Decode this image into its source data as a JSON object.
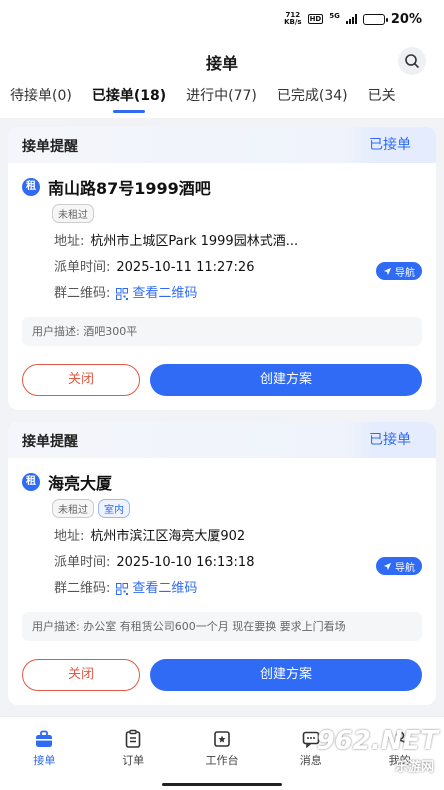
{
  "status_bar": {
    "speed": "712",
    "speed_unit": "KB/s",
    "hd": "HD",
    "network": "5G",
    "battery_level": 0.2,
    "battery": "20%"
  },
  "header": {
    "title": "接单"
  },
  "tabs": [
    {
      "label": "待接单(0)"
    },
    {
      "label": "已接单(18)",
      "active": true
    },
    {
      "label": "进行中(77)"
    },
    {
      "label": "已完成(34)"
    },
    {
      "label": "已关"
    }
  ],
  "cards": [
    {
      "head_title": "接单提醒",
      "status": "已接单",
      "badge": "租",
      "title": "南山路87号1999酒吧",
      "tags": [
        "未租过"
      ],
      "address_label": "地址:",
      "address": "杭州市上城区Park 1999园林式酒...",
      "nav_label": "导航",
      "time_label": "派单时间:",
      "time": "2025-10-11 11:27:26",
      "qr_label": "群二维码:",
      "qr_link": "查看二维码",
      "desc": "用户描述: 酒吧300平",
      "close_label": "关闭",
      "create_label": "创建方案"
    },
    {
      "head_title": "接单提醒",
      "status": "已接单",
      "badge": "租",
      "title": "海亮大厦",
      "tags": [
        "未租过",
        "室内"
      ],
      "address_label": "地址:",
      "address": "杭州市滨江区海亮大厦902",
      "nav_label": "导航",
      "time_label": "派单时间:",
      "time": "2025-10-10 16:13:18",
      "qr_label": "群二维码:",
      "qr_link": "查看二维码",
      "desc": "用户描述: 办公室 有租赁公司600一个月 现在要换 要求上门看场",
      "close_label": "关闭",
      "create_label": "创建方案"
    }
  ],
  "bottom_nav": [
    {
      "label": "接单",
      "icon": "briefcase-icon",
      "active": true
    },
    {
      "label": "订单",
      "icon": "clipboard-icon"
    },
    {
      "label": "工作台",
      "icon": "workbench-icon"
    },
    {
      "label": "消息",
      "icon": "message-icon"
    },
    {
      "label": "我的",
      "icon": "user-icon"
    }
  ],
  "watermark": {
    "text": "962.NET",
    "sub": "乐游网"
  },
  "colors": {
    "accent": "#2f6bf5",
    "danger": "#e05a45"
  }
}
